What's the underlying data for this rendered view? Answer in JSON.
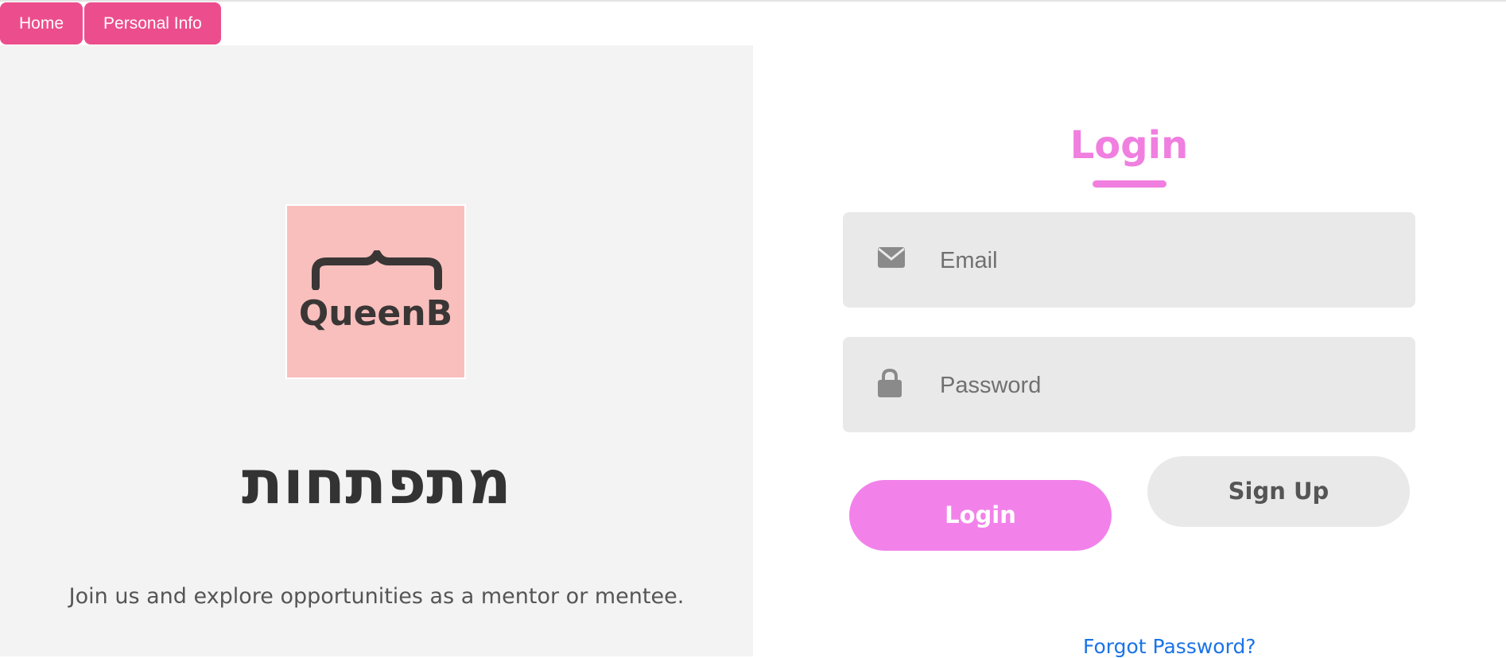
{
  "nav": {
    "home_label": "Home",
    "personal_info_label": "Personal Info"
  },
  "left": {
    "logo_text": "QueenB",
    "hebrew_title": "מתפתחות",
    "tagline": "Join us and explore opportunities as a mentor or mentee."
  },
  "login_form": {
    "title": "Login",
    "email_placeholder": "Email",
    "email_value": "",
    "password_placeholder": "Password",
    "password_value": "",
    "login_button": "Login",
    "signup_button": "Sign Up",
    "forgot_password": "Forgot Password?"
  },
  "icons": {
    "email": "envelope-icon",
    "password": "lock-icon"
  },
  "colors": {
    "nav_accent": "#ec4e8d",
    "login_pink": "#f282ea",
    "logo_bg": "#f9bfbd",
    "link_blue": "#1a73e8"
  }
}
